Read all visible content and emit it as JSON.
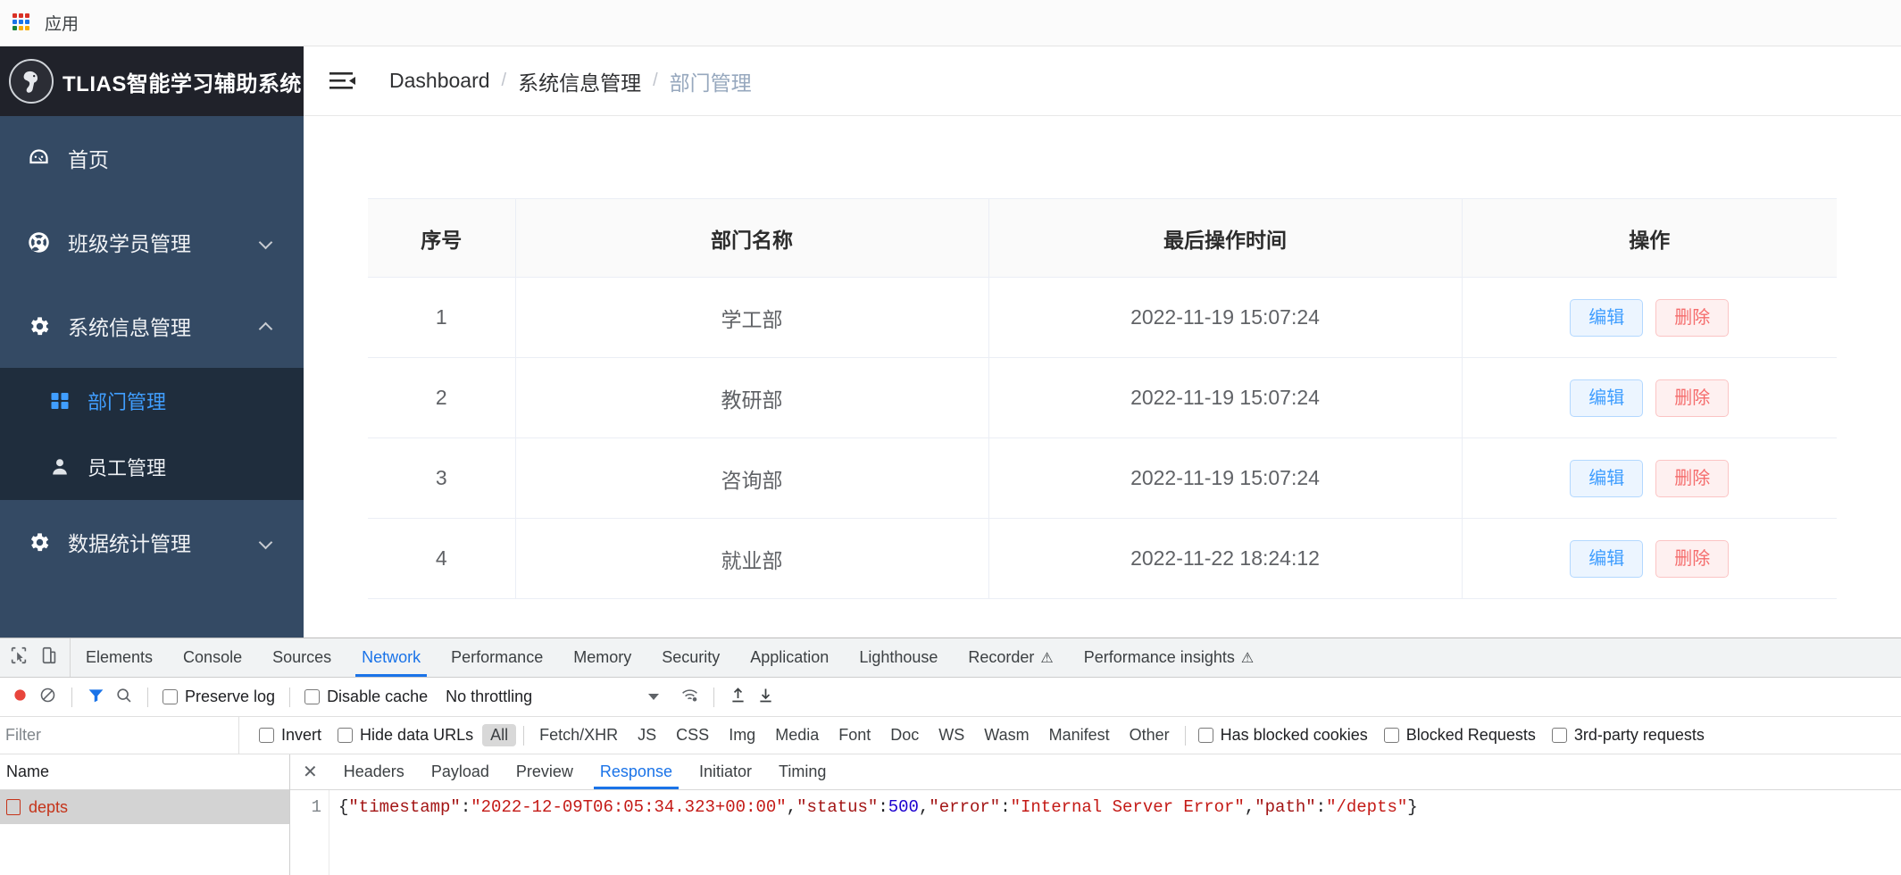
{
  "browser": {
    "bookmark_label": "应用",
    "apps_icon_colors": [
      "#d93025",
      "#d93025",
      "#d93025",
      "#1a73e8",
      "#1a73e8",
      "#1a73e8",
      "#188038",
      "#f9ab00",
      "#f9ab00"
    ]
  },
  "sidebar": {
    "brand_title": "TLIAS智能学习辅助系统",
    "brand_logo_icon": "horse-logo-icon",
    "items": [
      {
        "label": "首页",
        "icon": "dashboard-icon",
        "arrow": null
      },
      {
        "label": "班级学员管理",
        "icon": "lifebuoy-icon",
        "arrow": "down"
      },
      {
        "label": "系统信息管理",
        "icon": "gear-icon",
        "arrow": "up"
      }
    ],
    "submenu": [
      {
        "label": "部门管理",
        "icon": "grid-icon",
        "active": true
      },
      {
        "label": "员工管理",
        "icon": "user-icon",
        "active": false
      }
    ],
    "items_after": [
      {
        "label": "数据统计管理",
        "icon": "gear-icon",
        "arrow": "down"
      }
    ]
  },
  "topbar": {
    "collapse_icon": "hamburger-collapse-icon",
    "breadcrumb": [
      "Dashboard",
      "系统信息管理",
      "部门管理"
    ],
    "breadcrumb_separator": "/"
  },
  "table": {
    "headers": [
      "序号",
      "部门名称",
      "最后操作时间",
      "操作"
    ],
    "rows": [
      {
        "idx": "1",
        "name": "学工部",
        "time": "2022-11-19 15:07:24",
        "edit": "编辑",
        "delete": "删除"
      },
      {
        "idx": "2",
        "name": "教研部",
        "time": "2022-11-19 15:07:24",
        "edit": "编辑",
        "delete": "删除"
      },
      {
        "idx": "3",
        "name": "咨询部",
        "time": "2022-11-19 15:07:24",
        "edit": "编辑",
        "delete": "删除"
      },
      {
        "idx": "4",
        "name": "就业部",
        "time": "2022-11-22 18:24:12",
        "edit": "编辑",
        "delete": "删除"
      }
    ],
    "accent_edit": "#409eff",
    "accent_delete": "#f56c6c"
  },
  "devtools": {
    "panel_tabs": [
      {
        "label": "Elements",
        "active": false,
        "warn": false
      },
      {
        "label": "Console",
        "active": false,
        "warn": false
      },
      {
        "label": "Sources",
        "active": false,
        "warn": false
      },
      {
        "label": "Network",
        "active": true,
        "warn": false
      },
      {
        "label": "Performance",
        "active": false,
        "warn": false
      },
      {
        "label": "Memory",
        "active": false,
        "warn": false
      },
      {
        "label": "Security",
        "active": false,
        "warn": false
      },
      {
        "label": "Application",
        "active": false,
        "warn": false
      },
      {
        "label": "Lighthouse",
        "active": false,
        "warn": false
      },
      {
        "label": "Recorder",
        "active": false,
        "warn": true
      },
      {
        "label": "Performance insights",
        "active": false,
        "warn": true
      }
    ],
    "warn_glyph": "⚠",
    "netbar": {
      "record_icon": "record-stop-icon",
      "clear_icon": "clear-icon",
      "filter_icon": "filter-icon",
      "search_icon": "search-icon",
      "preserve_log": "Preserve log",
      "disable_cache": "Disable cache",
      "throttling": "No throttling",
      "wifi_icon": "network-conditions-icon",
      "import_icon": "import-har-icon",
      "export_icon": "export-har-icon"
    },
    "filterbar": {
      "filter_placeholder": "Filter",
      "invert": "Invert",
      "hide_data_urls": "Hide data URLs",
      "types": [
        "All",
        "Fetch/XHR",
        "JS",
        "CSS",
        "Img",
        "Media",
        "Font",
        "Doc",
        "WS",
        "Wasm",
        "Manifest",
        "Other"
      ],
      "selected_type": "All",
      "has_blocked_cookies": "Has blocked cookies",
      "blocked_requests": "Blocked Requests",
      "third_party": "3rd-party requests"
    },
    "requests": {
      "column_header": "Name",
      "rows": [
        {
          "name": "depts",
          "selected": true,
          "error": true
        }
      ]
    },
    "detail": {
      "close_glyph": "✕",
      "tabs": [
        {
          "label": "Headers",
          "active": false
        },
        {
          "label": "Payload",
          "active": false
        },
        {
          "label": "Preview",
          "active": false
        },
        {
          "label": "Response",
          "active": true
        },
        {
          "label": "Initiator",
          "active": false
        },
        {
          "label": "Timing",
          "active": false
        }
      ],
      "line_number": "1",
      "response_json": {
        "timestamp": "2022-12-09T06:05:34.323+00:00",
        "status": 500,
        "error": "Internal Server Error",
        "path": "/depts"
      }
    }
  }
}
